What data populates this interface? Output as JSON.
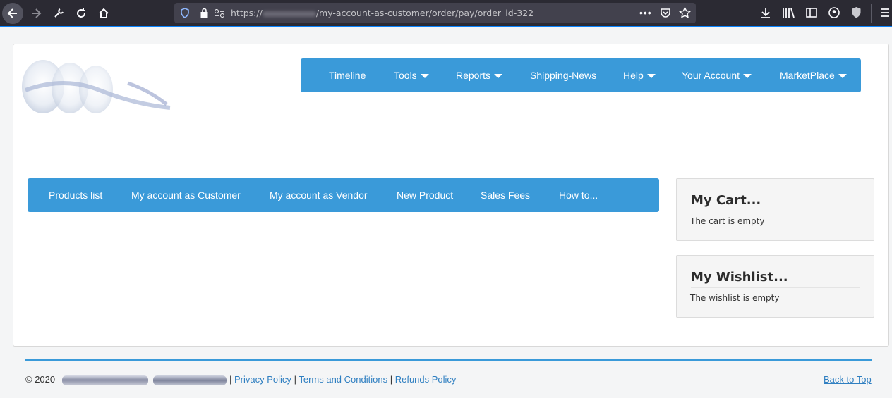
{
  "browser": {
    "url_prefix": "https://",
    "url_path": "/my-account-as-customer/order/pay/order_id-322"
  },
  "topnav": [
    {
      "label": "Timeline",
      "dropdown": false
    },
    {
      "label": "Tools",
      "dropdown": true
    },
    {
      "label": "Reports",
      "dropdown": true
    },
    {
      "label": "Shipping-News",
      "dropdown": false
    },
    {
      "label": "Help",
      "dropdown": true
    },
    {
      "label": "Your Account",
      "dropdown": true
    },
    {
      "label": "MarketPlace",
      "dropdown": true
    }
  ],
  "subnav": [
    {
      "label": "Products list"
    },
    {
      "label": "My account as Customer"
    },
    {
      "label": "My account as Vendor"
    },
    {
      "label": "New Product"
    },
    {
      "label": "Sales Fees"
    },
    {
      "label": "How to..."
    }
  ],
  "cart": {
    "title": "My Cart...",
    "status": "The cart is empty"
  },
  "wishlist": {
    "title": "My Wishlist...",
    "status": "The wishlist is empty"
  },
  "footer": {
    "copyright": "© 2020",
    "separator": "|",
    "privacy": "Privacy Policy",
    "terms": "Terms and Conditions",
    "refunds": "Refunds Policy",
    "back_to_top": "Back to Top"
  },
  "colors": {
    "nav_blue": "#3a9ad9",
    "link_blue": "#2f7fc1",
    "chrome_bg": "#2b2a33"
  }
}
